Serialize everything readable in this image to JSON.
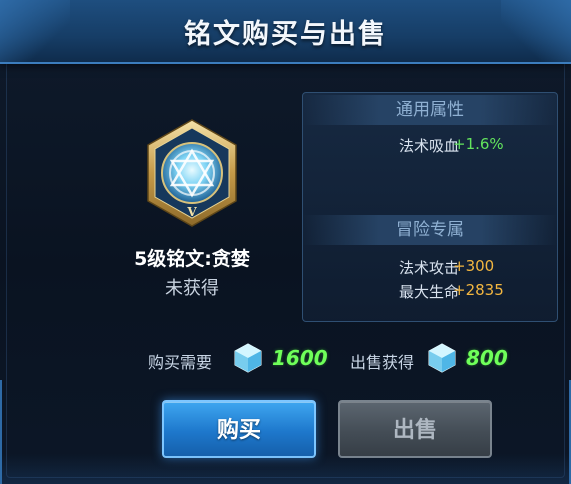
{
  "window": {
    "title": "铭文购买与出售"
  },
  "inscription": {
    "icon": "inscription-hexagon-icon",
    "name": "5级铭文:贪婪",
    "status": "未获得"
  },
  "attributes": {
    "general_header": "通用属性",
    "general": [
      {
        "name": "法术吸血",
        "value": "+1.6%",
        "color": "#63e35d"
      }
    ],
    "adventure_header": "冒险专属",
    "adventure": [
      {
        "name": "法术攻击",
        "value": "+300",
        "color": "#f2b640"
      },
      {
        "name": "最大生命",
        "value": "+2835",
        "color": "#f2b640"
      }
    ]
  },
  "trade": {
    "buy_label": "购买需要",
    "buy_amount": "1600",
    "sell_label": "出售获得",
    "sell_amount": "800",
    "currency_icon": "crystal-icon",
    "amount_color": "#6fff5a"
  },
  "buttons": {
    "buy": "购买",
    "sell": "出售"
  },
  "colors": {
    "accent": "#2e86de",
    "panel_border": "#2f4f72"
  }
}
